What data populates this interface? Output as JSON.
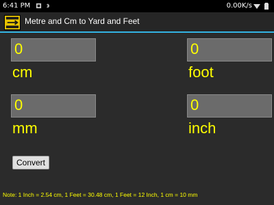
{
  "status_bar": {
    "time": "6:41 PM",
    "network_speed": "0.00K/s"
  },
  "app": {
    "title": "Metre and Cm to Yard and Feet",
    "icon_name": "ruler-conversion-icon"
  },
  "fields": {
    "cm": {
      "value": "0",
      "unit": "cm"
    },
    "foot": {
      "value": "0",
      "unit": "foot"
    },
    "mm": {
      "value": "0",
      "unit": "mm"
    },
    "inch": {
      "value": "0",
      "unit": "inch"
    }
  },
  "convert_label": "Convert",
  "note": "Note: 1 Inch = 2.54 cm, 1 Feet = 30.48 cm, 1 Feet = 12 Inch, 1 cm = 10 mm",
  "colors": {
    "accent": "#33b5e5",
    "text_yellow": "#ffff00",
    "background": "#2b2b2b"
  }
}
